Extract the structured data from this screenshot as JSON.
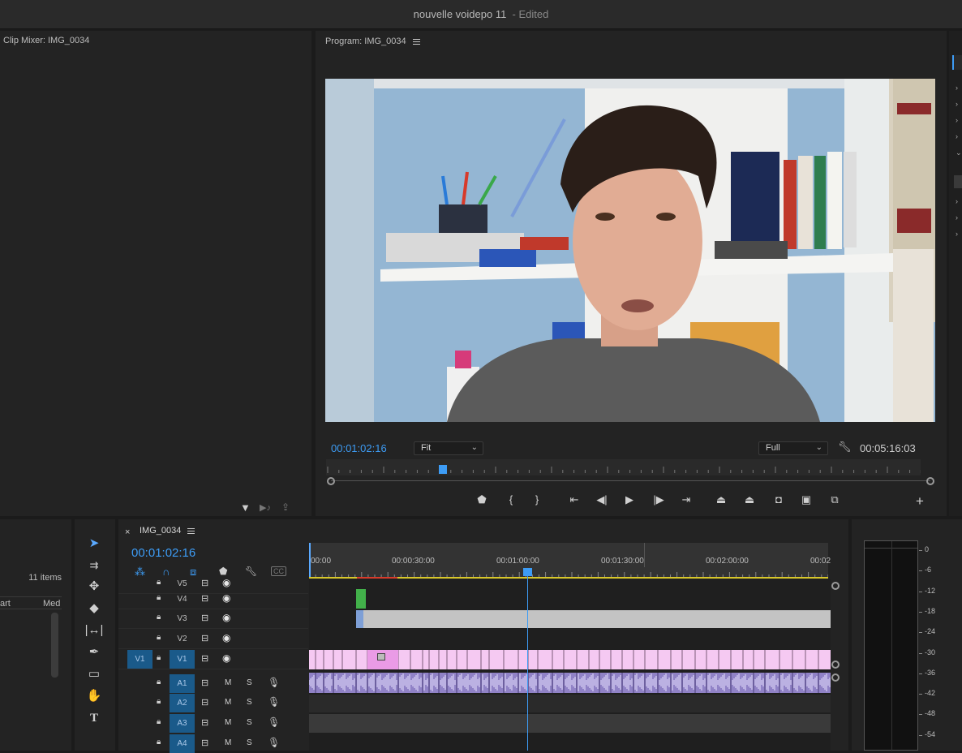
{
  "window": {
    "title": "nouvelle voidepo 11",
    "status": "- Edited"
  },
  "clip_mixer": {
    "title": "Clip Mixer: IMG_0034"
  },
  "program": {
    "title": "Program: IMG_0034",
    "current_timecode": "00:01:02:16",
    "fit_value": "Fit",
    "quality_value": "Full",
    "duration": "00:05:16:03",
    "playhead_fraction": 0.196
  },
  "project": {
    "items_count": "11 items",
    "col_start": "art",
    "col_media": "Med"
  },
  "timeline": {
    "tab_close": "×",
    "sequence_name": "IMG_0034",
    "timecode": "00:01:02:16",
    "ruler_labels": [
      "00:00",
      "00:00:30:00",
      "00:01:00:00",
      "00:01:30:00",
      "00:02:00:00",
      "00:02"
    ],
    "video_tracks": [
      {
        "name": "V5"
      },
      {
        "name": "V4"
      },
      {
        "name": "V3"
      },
      {
        "name": "V2"
      },
      {
        "name": "V1",
        "source": "V1"
      }
    ],
    "audio_tracks": [
      {
        "name": "A1",
        "mute": "M",
        "solo": "S"
      },
      {
        "name": "A2",
        "mute": "M",
        "solo": "S"
      },
      {
        "name": "A3",
        "mute": "M",
        "solo": "S"
      },
      {
        "name": "A4",
        "mute": "M",
        "solo": "S"
      }
    ]
  },
  "audio_meter": {
    "scale": [
      "0",
      "-6",
      "-12",
      "-18",
      "-24",
      "-30",
      "-36",
      "-42",
      "-48",
      "-54"
    ]
  },
  "colors": {
    "accent_blue": "#3d9cf5",
    "clip_pink": "#f2b8ef",
    "audio_purple": "#8f7fc2",
    "track_target": "#1a5a8a"
  }
}
